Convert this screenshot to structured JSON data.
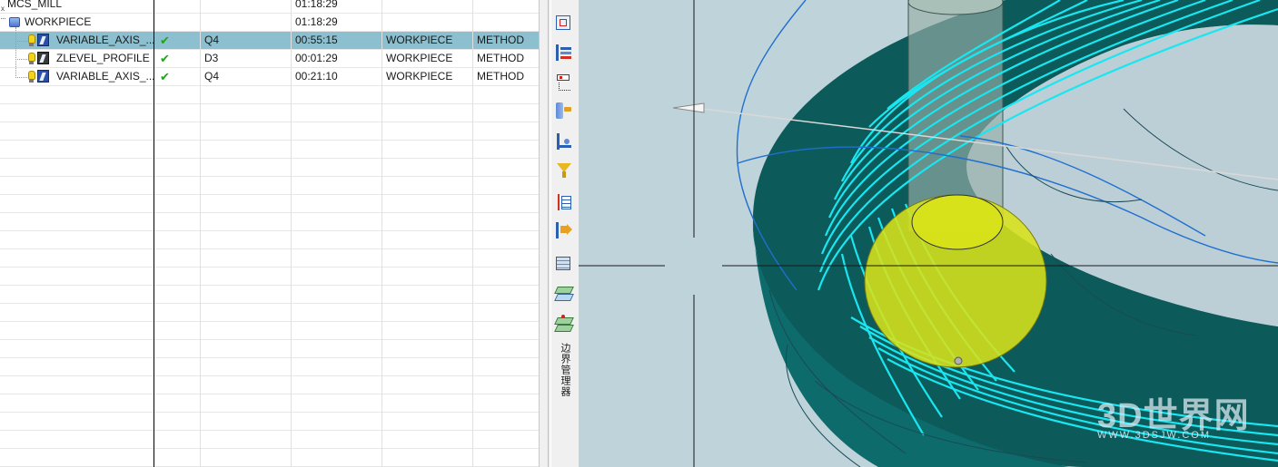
{
  "navigator": {
    "rows": [
      {
        "name": "MCS_MILL",
        "path": "",
        "tool": "",
        "time": "01:18:29",
        "geometry": "",
        "method": "",
        "level": 0,
        "kind": "mcs"
      },
      {
        "name": "WORKPIECE",
        "path": "",
        "tool": "",
        "time": "01:18:29",
        "geometry": "",
        "method": "",
        "level": 1,
        "kind": "workpiece"
      },
      {
        "name": "VARIABLE_AXIS_...",
        "path": "✔",
        "tool": "Q4",
        "time": "00:55:15",
        "geometry": "WORKPIECE",
        "method": "METHOD",
        "level": 2,
        "kind": "operation",
        "selected": true
      },
      {
        "name": "ZLEVEL_PROFILE",
        "path": "✔",
        "tool": "D3",
        "time": "00:01:29",
        "geometry": "WORKPIECE",
        "method": "METHOD",
        "level": 2,
        "kind": "operation"
      },
      {
        "name": "VARIABLE_AXIS_...",
        "path": "✔",
        "tool": "Q4",
        "time": "00:21:10",
        "geometry": "WORKPIECE",
        "method": "METHOD",
        "level": 2,
        "kind": "operation"
      }
    ]
  },
  "toolbar": {
    "buttons": [
      {
        "icon": "fit-view-icon"
      },
      {
        "icon": "program-order-view-icon"
      },
      {
        "icon": "machine-tool-view-icon"
      },
      {
        "icon": "geometry-view-icon"
      },
      {
        "icon": "machining-method-view-icon"
      },
      {
        "icon": "filter-icon"
      },
      {
        "icon": "list-columns-icon"
      },
      {
        "icon": "toolpath-replay-icon"
      },
      {
        "icon": "feature-navigator-icon"
      },
      {
        "icon": "layer-settings-icon"
      },
      {
        "icon": "layer-move-icon"
      }
    ],
    "vertical_label": "边界管理器"
  },
  "viewport": {
    "background": "#bfd3da",
    "part_color": "#0c5a5a",
    "toolpath_color": "#19e6f0",
    "tool_ball_color": "#d8e21a"
  },
  "watermark": {
    "main": "3D世界网",
    "sub": "WWW.3DSJW.COM"
  }
}
